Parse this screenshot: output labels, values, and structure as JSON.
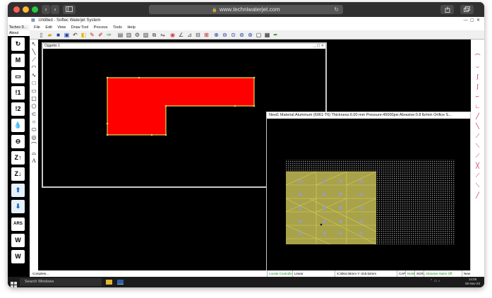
{
  "browser": {
    "url": "www.techniwaterjet.com",
    "nav_back": "‹",
    "nav_forward": "›",
    "reload": "↻"
  },
  "app": {
    "title": "Untitled - Softec Waterjet System",
    "menus": [
      "File",
      "Edit",
      "View",
      "Draw Tool",
      "Process",
      "Tools",
      "Help"
    ],
    "left_panel_title": "Techno D...",
    "left_panel_tab": "About",
    "left_buttons": [
      "↻",
      "M",
      "▭",
      "!1",
      "!2",
      "💧",
      "⊖",
      "Z↑",
      "Z↓",
      "⬆",
      "⬇",
      "ARS",
      "W",
      "W"
    ]
  },
  "window1": {
    "title": "Oggetto 1",
    "shape_color": "#ff0000",
    "outline_color": "#e8d24a"
  },
  "window2": {
    "title": "Nest1  Material:Aluminum  (6061-T6)  Thickness:6.00 mm  Pressure:45000psi  Abrasive:0.8 lb/min  Orifice S...",
    "grid_color": "#a8a24a",
    "part_color": "#d8d058"
  },
  "status": {
    "left": "Complete...",
    "locate": "Locate Controller",
    "mode": "Linear",
    "coords": "X:3064.06mm Y:-318.52mm",
    "cap": "CAP",
    "num": "NUM",
    "scrl": "SCRL",
    "alarm": "Abrasive Alarm Off",
    "new": "New"
  },
  "taskbar": {
    "search_placeholder": "Search Windows",
    "time": "14:05",
    "date": "05-Nov-23"
  }
}
